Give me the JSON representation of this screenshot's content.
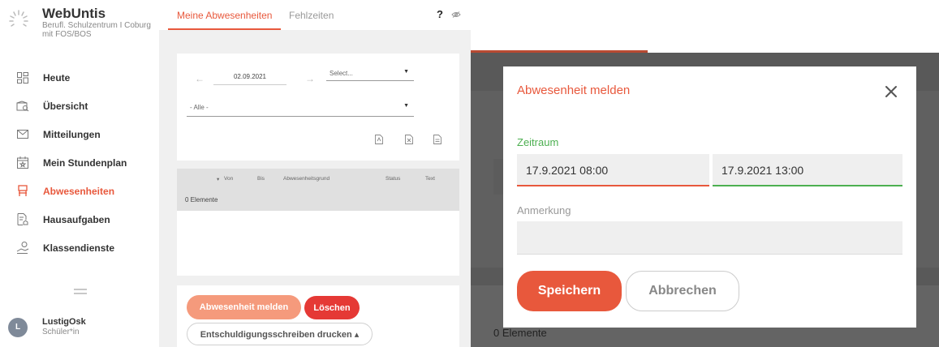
{
  "brand": {
    "name": "WebUntis",
    "school": "Berufl. Schulzentrum I Coburg mit FOS/BOS"
  },
  "nav": {
    "items": [
      {
        "label": "Heute",
        "icon": "dashboard-icon"
      },
      {
        "label": "Übersicht",
        "icon": "overview-icon"
      },
      {
        "label": "Mitteilungen",
        "icon": "mail-icon"
      },
      {
        "label": "Mein Stundenplan",
        "icon": "calendar-icon"
      },
      {
        "label": "Abwesenheiten",
        "icon": "absence-icon",
        "active": true
      },
      {
        "label": "Hausaufgaben",
        "icon": "homework-icon"
      },
      {
        "label": "Klassendienste",
        "icon": "class-duty-icon"
      }
    ]
  },
  "user": {
    "initial": "L",
    "name": "LustigOsk",
    "role": "Schüler*in"
  },
  "tabs": {
    "absences": "Meine Abwesenheiten",
    "missed": "Fehlzeiten",
    "help": "?"
  },
  "filter": {
    "date": "02.09.2021",
    "select_placeholder": "Select...",
    "category": "- Alle -"
  },
  "table": {
    "columns": [
      "Von",
      "Bis",
      "Abwesenheitsgrund",
      "Status",
      "Text"
    ],
    "sort_indicator": "▾",
    "count": "0 Elemente"
  },
  "actions": {
    "report": "Abwesenheit melden",
    "delete": "Löschen",
    "print": "Entschuldigungsschreiben drucken ▴"
  },
  "background": {
    "count": "0 Elemente"
  },
  "modal": {
    "title": "Abwesenheit melden",
    "period_label": "Zeitraum",
    "from": "17.9.2021 08:00",
    "to": "17.9.2021 13:00",
    "note_label": "Anmerkung",
    "note_value": "",
    "save": "Speichern",
    "cancel": "Abbrechen"
  },
  "colors": {
    "accent": "#e8583c",
    "success": "#4caf50",
    "danger": "#e53935"
  }
}
